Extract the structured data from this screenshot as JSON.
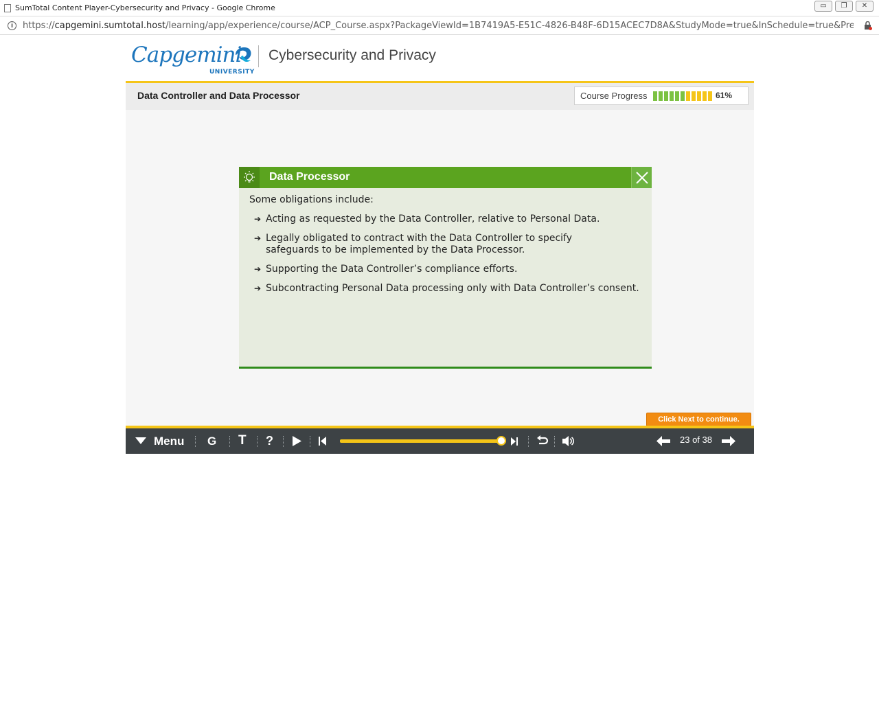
{
  "browser": {
    "window_title": "SumTotal Content Player-Cybersecurity and Privacy - Google Chrome",
    "url_scheme": "https://",
    "url_host": "capgemini.sumtotal.host",
    "url_path": "/learning/app/experience/course/ACP_Course.aspx?PackageViewId=1B7419A5-E51C-4826-B48F-6D15ACEC7D8A&StudyMode=true&InSchedule=true&Preview=...",
    "controls": {
      "minimize": "▭",
      "restore": "❐",
      "close": "✕"
    }
  },
  "header": {
    "logo_word": "Capgemini",
    "logo_sub": "UNIVERSITY",
    "course_title": "Cybersecurity and Privacy"
  },
  "slide": {
    "title": "Data Controller and Data Processor",
    "progress_label": "Course Progress",
    "progress_percent": "61%",
    "progress_segments": [
      "#7cc242",
      "#7cc242",
      "#7cc242",
      "#7cc242",
      "#7cc242",
      "#7cc242",
      "#f5c518",
      "#f5c518",
      "#f5c518",
      "#f5c518",
      "#f5c518"
    ]
  },
  "popup": {
    "title": "Data Processor",
    "intro": "Some obligations include:",
    "items": [
      "Acting as requested by the Data Controller, relative to Personal Data.",
      "Legally obligated to contract with the Data Controller to specify safeguards to be implemented by the Data Processor.",
      "Supporting the Data Controller’s compliance efforts.",
      "Subcontracting Personal Data processing only with Data Controller’s consent."
    ]
  },
  "tooltip": {
    "click_next": "Click Next to continue."
  },
  "player": {
    "menu_label": "Menu",
    "glossary_label": "G",
    "transcript_label": "T",
    "help_label": "?",
    "page_counter": "23 of 38",
    "playback_fraction": 0.97
  },
  "colors": {
    "brand_blue": "#1c75bc",
    "accent_yellow": "#f5c518",
    "popup_green": "#5ba41f",
    "player_bg": "#3d4245",
    "tooltip_orange": "#f28c12"
  }
}
